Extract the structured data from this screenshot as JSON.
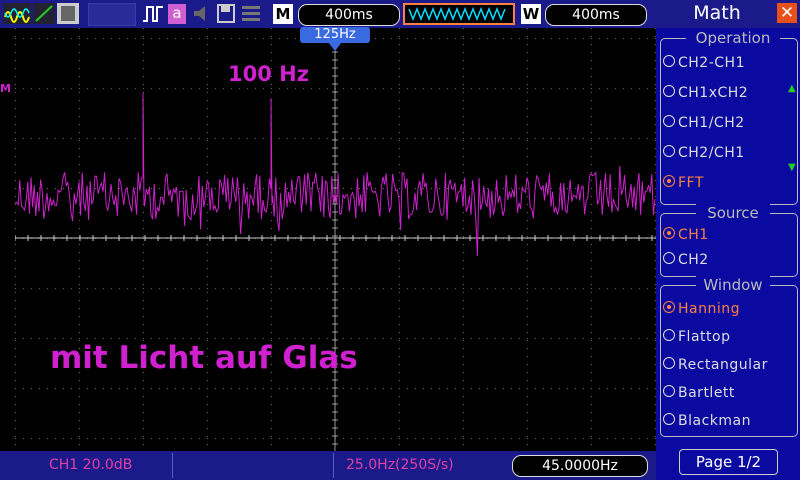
{
  "topbar": {
    "timebase": "400ms",
    "window_timebase": "400ms",
    "letter_m": "M",
    "letter_w": "W",
    "icon_a": "a",
    "trigger_marker": "125Hz"
  },
  "side": {
    "title": "Math",
    "groups": {
      "operation": "Operation",
      "source": "Source",
      "window": "Window"
    },
    "operation_items": [
      "CH2-CH1",
      "CH1xCH2",
      "CH1/CH2",
      "CH2/CH1",
      "FFT"
    ],
    "operation_selected": 4,
    "source_items": [
      "CH1",
      "CH2"
    ],
    "source_selected": 0,
    "window_items": [
      "Hanning",
      "Flattop",
      "Rectangular",
      "Bartlett",
      "Blackman"
    ],
    "window_selected": 0,
    "page": "Page 1/2"
  },
  "bottombar": {
    "ch1_scale": "CH1 20.0dB",
    "sample": "25.0Hz(250S/s)",
    "cursor_freq": "45.0000Hz"
  },
  "annotations": {
    "peak_label": "100 Hz",
    "caption": "mit Licht auf Glas"
  },
  "colors": {
    "trace": "#cc22cc",
    "grid": "#666666",
    "selected": "#ff8040",
    "panel": "#0a0aa0",
    "bar": "#1a1a8a"
  },
  "icons": [
    "ch1-waveform-icon",
    "cursor-icon",
    "print-icon",
    "pulse-icon",
    "speaker-icon",
    "save-icon",
    "menu-icon"
  ]
}
